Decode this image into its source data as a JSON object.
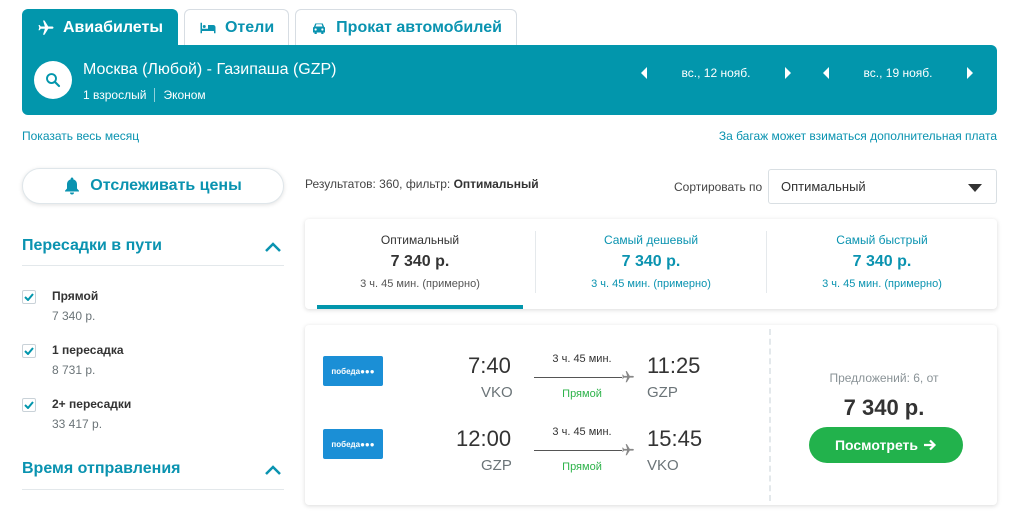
{
  "tabs": [
    {
      "label": "Авиабилеты",
      "icon": "plane-icon",
      "active": true
    },
    {
      "label": "Отели",
      "icon": "bed-icon",
      "active": false
    },
    {
      "label": "Прокат автомобилей",
      "icon": "car-icon",
      "active": false
    }
  ],
  "search": {
    "route": "Москва (Любой) - Газипаша (GZP)",
    "passengers": "1 взрослый",
    "cabin": "Эконом",
    "depart_date": "вс., 12 нояб.",
    "return_date": "вс., 19 нояб."
  },
  "links": {
    "show_month": "Показать весь месяц",
    "baggage_fee": "За багаж может взиматься дополнительная плата"
  },
  "sidebar": {
    "track_label": "Отслеживать цены",
    "stops_title": "Пересадки в пути",
    "stops": [
      {
        "name": "Прямой",
        "price": "7 340 р.",
        "checked": true
      },
      {
        "name": "1 пересадка",
        "price": "8 731 р.",
        "checked": true
      },
      {
        "name": "2+ пересадки",
        "price": "33 417 р.",
        "checked": true
      }
    ],
    "departure_title": "Время отправления"
  },
  "results": {
    "count_prefix": "Результатов: 360, фильтр: ",
    "filter_name": "Оптимальный",
    "sort_label": "Сортировать по",
    "sort_value": "Оптимальный"
  },
  "sort_tabs": [
    {
      "title": "Оптимальный",
      "price": "7 340 р.",
      "duration": "3 ч. 45 мин. (примерно)",
      "active": true
    },
    {
      "title": "Самый дешевый",
      "price": "7 340 р.",
      "duration": "3 ч. 45 мин. (примерно)",
      "active": false
    },
    {
      "title": "Самый быстрый",
      "price": "7 340 р.",
      "duration": "3 ч. 45 мин. (примерно)",
      "active": false
    }
  ],
  "ticket": {
    "legs": [
      {
        "airline": "победа",
        "dep_time": "7:40",
        "dep_code": "VKO",
        "duration": "3 ч. 45 мин.",
        "stops": "Прямой",
        "arr_time": "11:25",
        "arr_code": "GZP"
      },
      {
        "airline": "победа",
        "dep_time": "12:00",
        "dep_code": "GZP",
        "duration": "3 ч. 45 мин.",
        "stops": "Прямой",
        "arr_time": "15:45",
        "arr_code": "VKO"
      }
    ],
    "offers": "Предложений: 6, от",
    "price": "7 340 р.",
    "view_label": "Посмотреть"
  },
  "colors": {
    "accent": "#0296ac",
    "link": "#0a93b0",
    "cta": "#22b24c",
    "direct": "#2db34a"
  }
}
